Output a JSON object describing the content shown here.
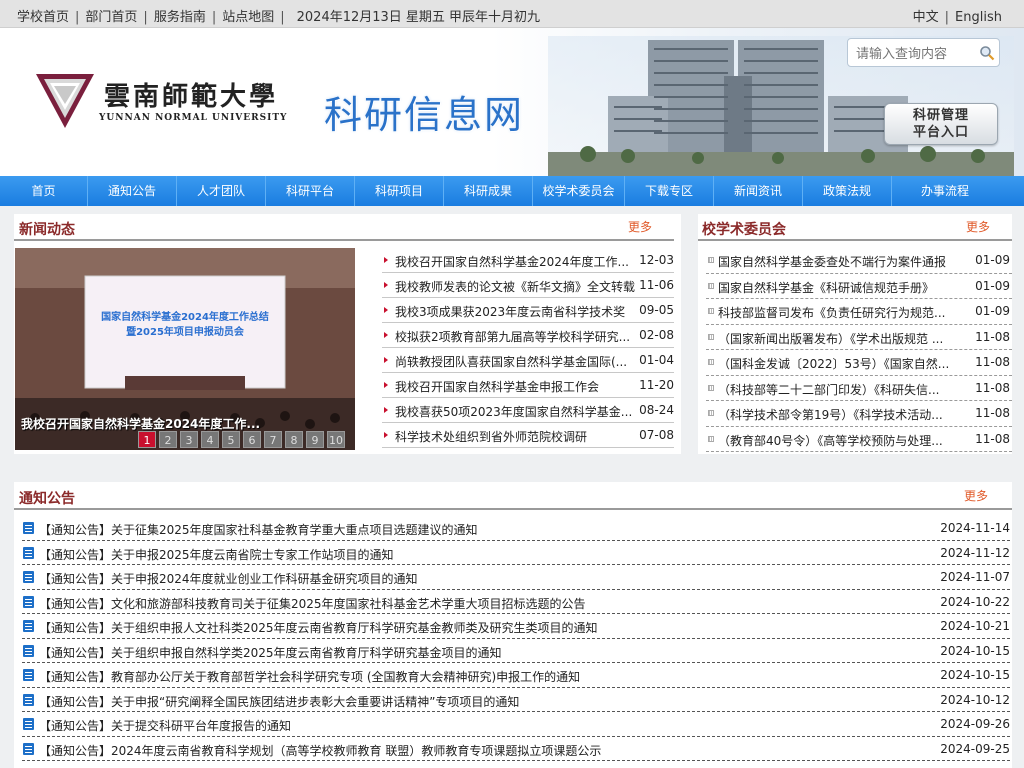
{
  "topbar": {
    "links": [
      "学校首页",
      "部门首页",
      "服务指南",
      "站点地图"
    ],
    "date": "2024年12月13日  星期五  甲辰年十月初九",
    "lang_cn": "中文",
    "lang_en": "English"
  },
  "header": {
    "logo_cn": "雲南師範大學",
    "logo_en": "YUNNAN NORMAL UNIVERSITY",
    "site_title": "科研信息网",
    "search_placeholder": "请输入查询内容",
    "entry_line1": "科研管理",
    "entry_line2": "平台入口"
  },
  "nav": [
    "首页",
    "通知公告",
    "人才团队",
    "科研平台",
    "科研项目",
    "科研成果",
    "校学术委员会",
    "下载专区",
    "新闻资讯",
    "政策法规",
    "办事流程"
  ],
  "news": {
    "title": "新闻动态",
    "more": "更多",
    "caption": "我校召开国家自然科学基金2024年度工作...",
    "slide_heading": "国家自然科学基金2024年度工作总结",
    "slide_subheading": "暨2025年项目申报动员会",
    "pager": [
      "1",
      "2",
      "3",
      "4",
      "5",
      "6",
      "7",
      "8",
      "9",
      "10"
    ],
    "items": [
      {
        "title": "我校召开国家自然科学基金2024年度工作...",
        "date": "12-03"
      },
      {
        "title": "我校教师发表的论文被《新华文摘》全文转载",
        "date": "11-06"
      },
      {
        "title": "我校3项成果获2023年度云南省科学技术奖",
        "date": "09-05"
      },
      {
        "title": "校拟获2项教育部第九届高等学校科学研究...",
        "date": "02-08"
      },
      {
        "title": "尚轶教授团队喜获国家自然科学基金国际(...",
        "date": "01-04"
      },
      {
        "title": "我校召开国家自然科学基金申报工作会",
        "date": "11-20"
      },
      {
        "title": "我校喜获50项2023年度国家自然科学基金...",
        "date": "08-24"
      },
      {
        "title": "科学技术处组织到省外师范院校调研",
        "date": "07-08"
      }
    ]
  },
  "committee": {
    "title": "校学术委员会",
    "more": "更多",
    "items": [
      {
        "title": "国家自然科学基金委查处不端行为案件通报",
        "date": "01-09"
      },
      {
        "title": "国家自然科学基金《科研诚信规范手册》",
        "date": "01-09"
      },
      {
        "title": "科技部监督司发布《负责任研究行为规范...",
        "date": "01-09"
      },
      {
        "title": "（国家新闻出版署发布）《学术出版规范 ...",
        "date": "11-08"
      },
      {
        "title": "（国科金发诚〔2022〕53号）《国家自然...",
        "date": "11-08"
      },
      {
        "title": "（科技部等二十二部门印发）《科研失信...",
        "date": "11-08"
      },
      {
        "title": "（科学技术部令第19号）《科学技术活动...",
        "date": "11-08"
      },
      {
        "title": "（教育部40号令）《高等学校预防与处理...",
        "date": "11-08"
      }
    ]
  },
  "notices": {
    "title": "通知公告",
    "more": "更多",
    "items": [
      {
        "title": "【通知公告】关于征集2025年度国家社科基金教育学重大重点项目选题建议的通知",
        "date": "2024-11-14"
      },
      {
        "title": "【通知公告】关于申报2025年度云南省院士专家工作站项目的通知",
        "date": "2024-11-12"
      },
      {
        "title": "【通知公告】关于申报2024年度就业创业工作科研基金研究项目的通知",
        "date": "2024-11-07"
      },
      {
        "title": "【通知公告】文化和旅游部科技教育司关于征集2025年度国家社科基金艺术学重大项目招标选题的公告",
        "date": "2024-10-22"
      },
      {
        "title": "【通知公告】关于组织申报人文社科类2025年度云南省教育厅科学研究基金教师类及研究生类项目的通知",
        "date": "2024-10-21"
      },
      {
        "title": "【通知公告】关于组织申报自然科学类2025年度云南省教育厅科学研究基金项目的通知",
        "date": "2024-10-15"
      },
      {
        "title": "【通知公告】教育部办公厅关于教育部哲学社会科学研究专项 (全国教育大会精神研究)申报工作的通知",
        "date": "2024-10-15"
      },
      {
        "title": "【通知公告】关于申报“研究阐释全国民族团结进步表彰大会重要讲话精神”专项项目的通知",
        "date": "2024-10-12"
      },
      {
        "title": "【通知公告】关于提交科研平台年度报告的通知",
        "date": "2024-09-26"
      },
      {
        "title": "【通知公告】2024年度云南省教育科学规划（高等学校教师教育 联盟）教师教育专项课题拟立项课题公示",
        "date": "2024-09-25"
      }
    ]
  }
}
